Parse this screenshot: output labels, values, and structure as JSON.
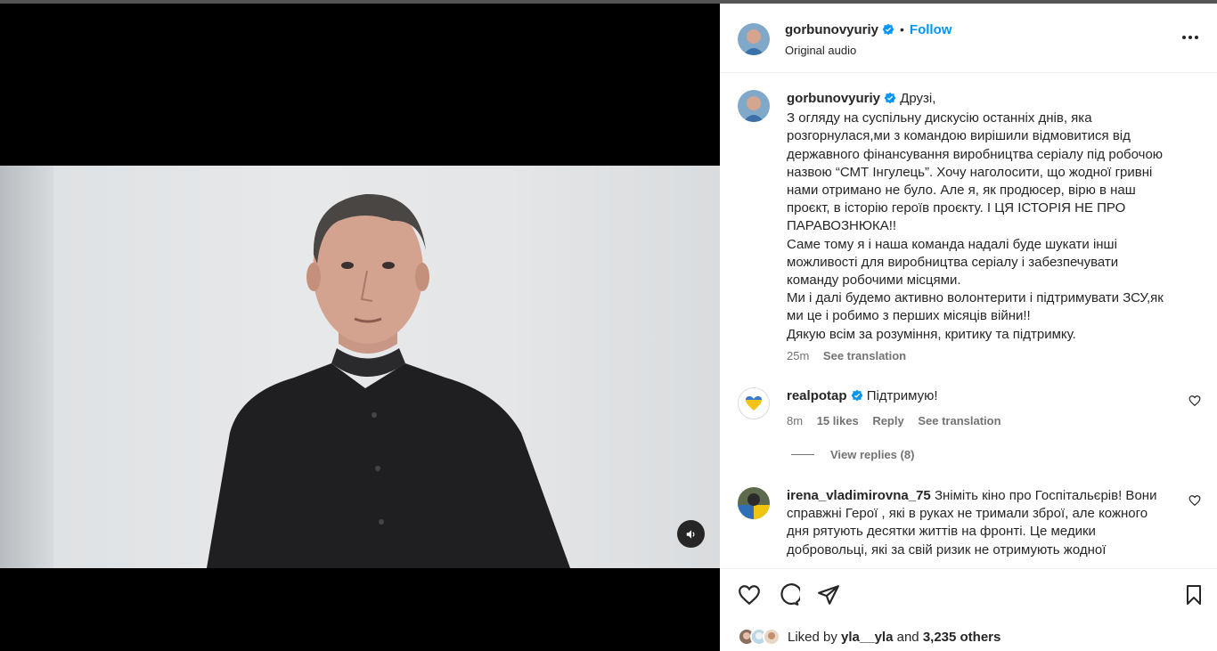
{
  "header": {
    "username": "gorbunovyuriy",
    "separator": "•",
    "follow_label": "Follow",
    "audio": "Original audio"
  },
  "caption": {
    "username": "gorbunovyuriy",
    "lines": [
      "Друзі,",
      "З огляду на суспільну дискусію останніх днів, яка",
      "розгорнулася,ми з командою вирішили відмовитися від",
      "державного фінансування виробництва серіалу під робочою",
      "назвою “СМТ Інгулець”. Хочу наголосити, що жодної гривні",
      "нами отримано не було. Але я, як продюсер, вірю в наш",
      "проєкт, в історію героїв проєкту. І ЦЯ ІСТОРІЯ НЕ ПРО",
      "ПАРАВОЗНЮКА!!",
      "Саме тому я і наша команда надалі буде шукати інші",
      "можливості для виробництва серіалу і забезпечувати",
      "команду робочими місцями.",
      "Ми і далі будемо активно волонтерити і підтримувати ЗСУ,як",
      "ми це і робимо з перших місяців війни!!",
      "Дякую всім за розуміння, критику та підтримку."
    ],
    "time": "25m",
    "see_translation": "See translation"
  },
  "comments": [
    {
      "username": "realpotap",
      "text": "Підтримую!",
      "time": "8m",
      "likes": "15 likes",
      "reply": "Reply",
      "see_translation": "See translation",
      "view_replies": "View replies (8)"
    },
    {
      "username": "irena_vladimirovna_75",
      "lines": [
        "Зніміть кіно про Госпітальєрів! Вони",
        "справжні Герої , які в руках не тримали зброї, але кожного",
        "дня рятують десятки життів на фронті. Це медики",
        "добровольці, які за свій ризик не отримують жодної"
      ]
    }
  ],
  "likes": {
    "prefix": "Liked by",
    "user": "yla__yla",
    "middle": "and",
    "count": "3,235 others"
  },
  "colors": {
    "accent": "#0095f6",
    "text": "#262626",
    "muted": "#737373",
    "verified": "#0095f6"
  }
}
